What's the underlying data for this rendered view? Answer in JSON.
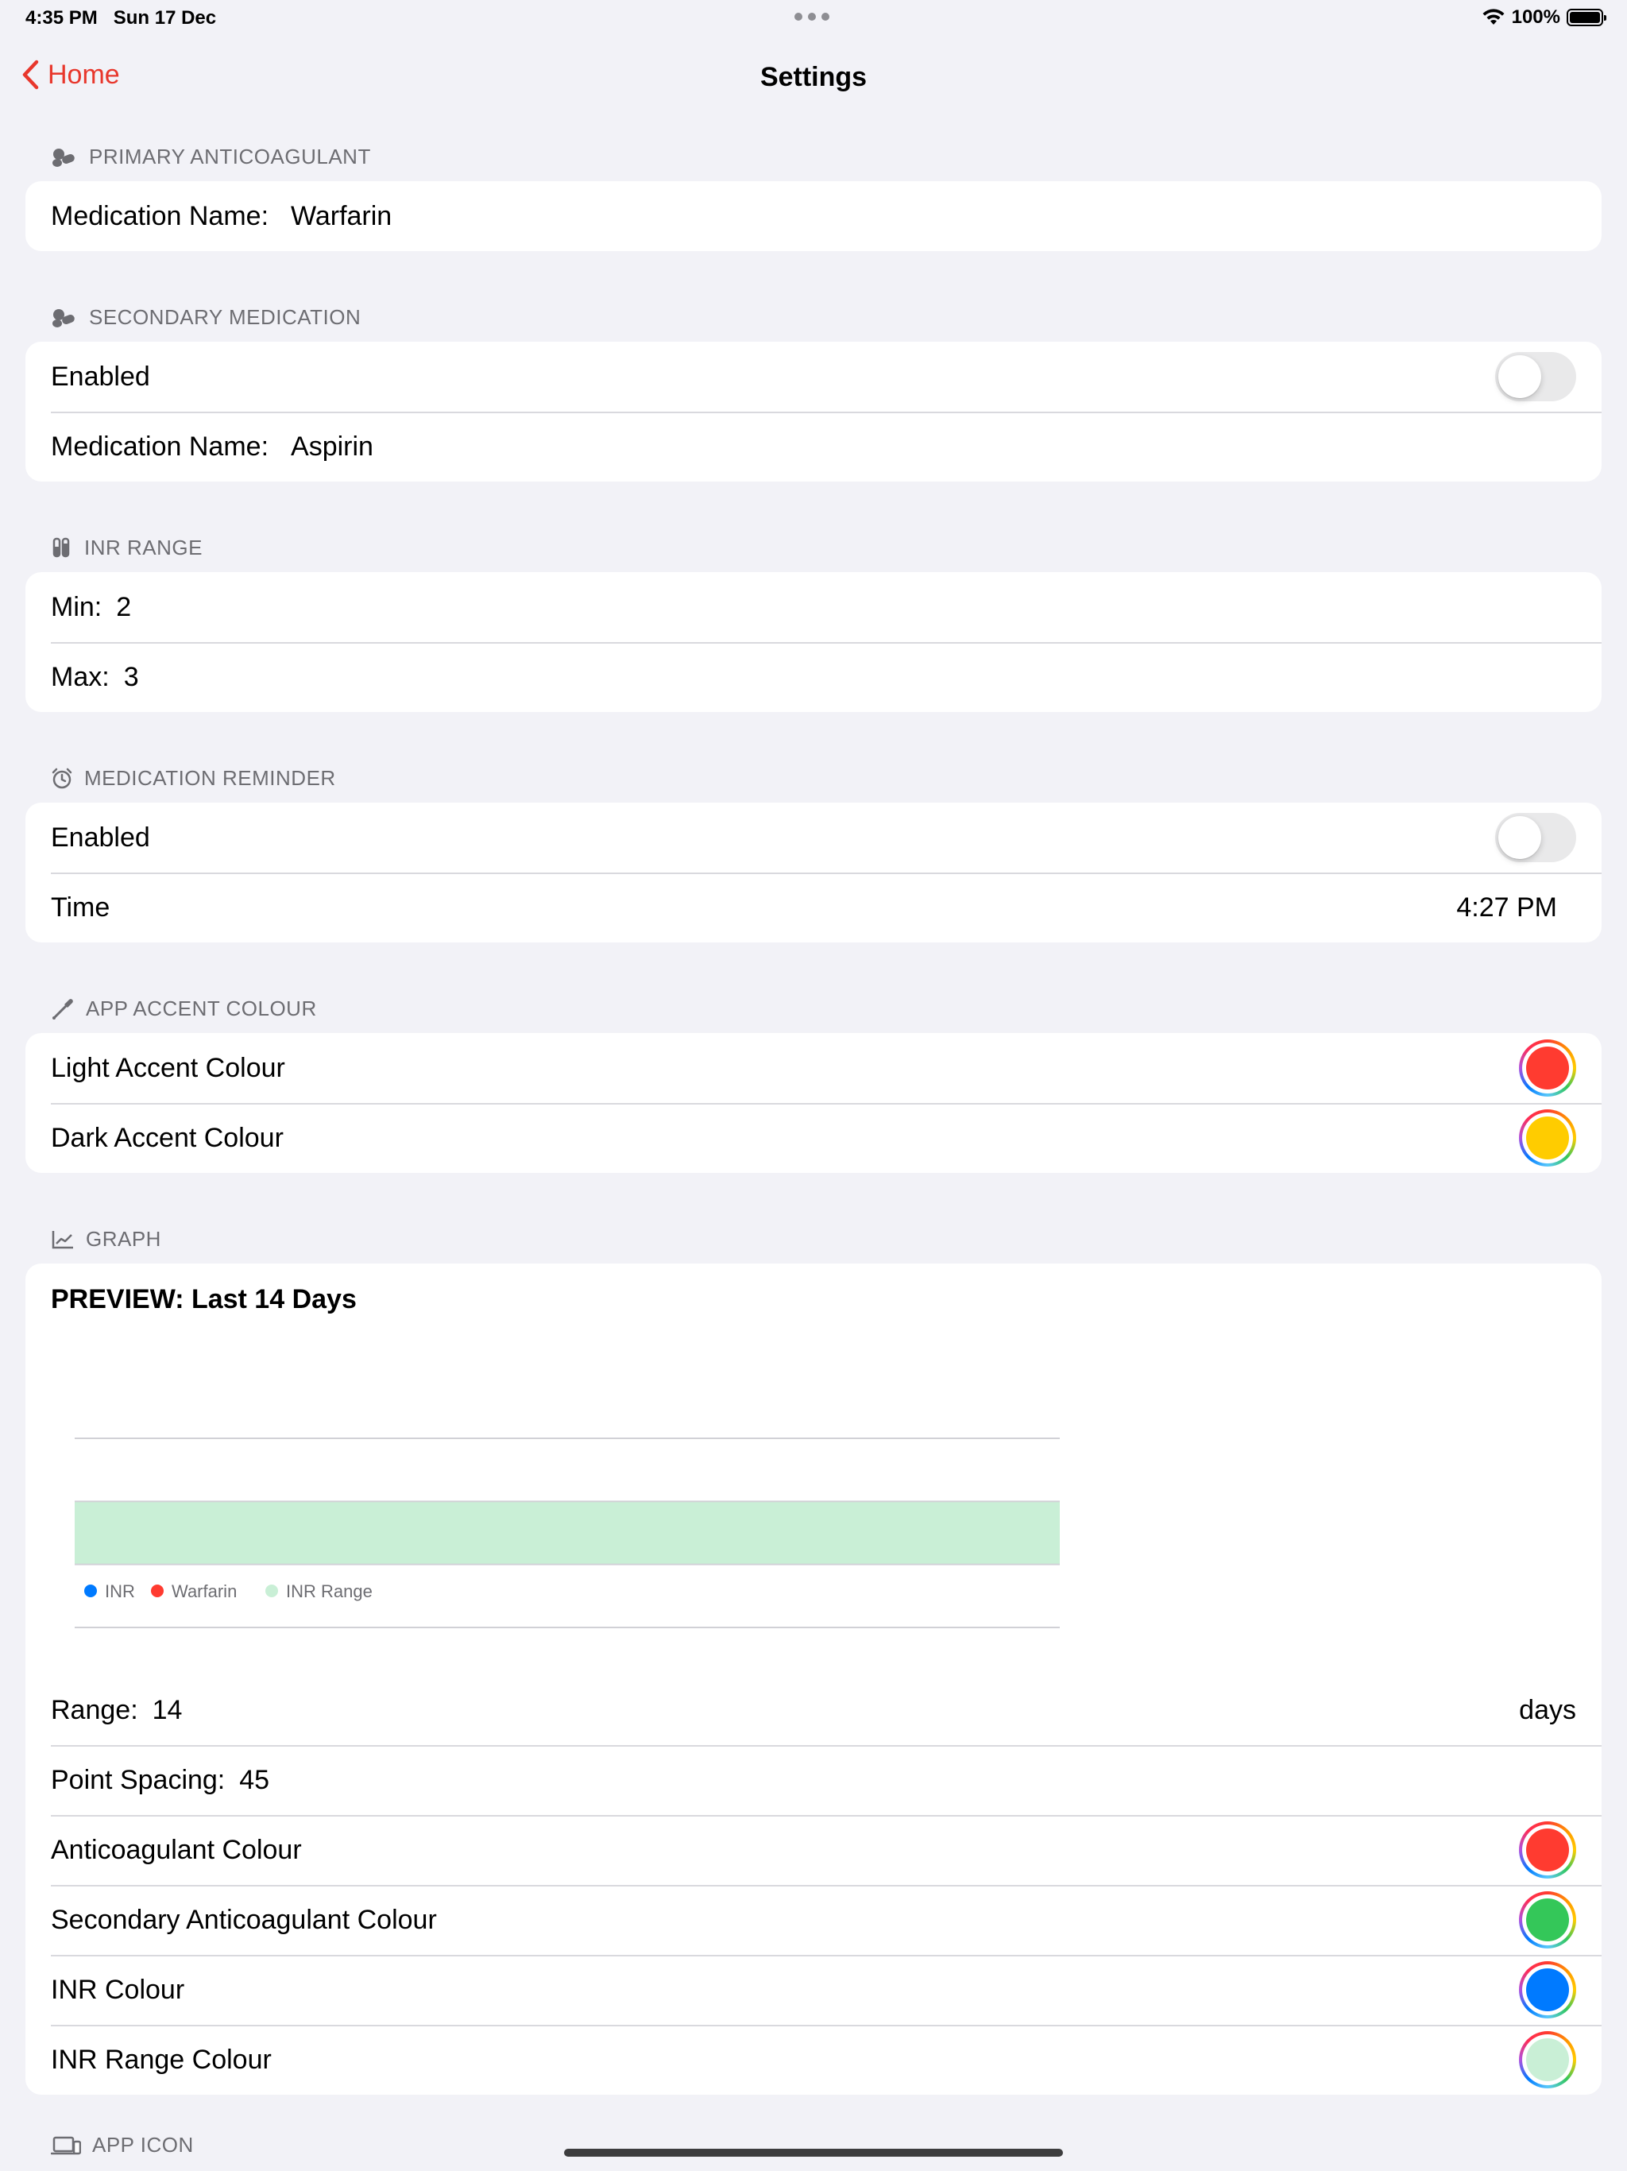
{
  "status_bar": {
    "time": "4:35 PM",
    "date": "Sun 17 Dec",
    "battery": "100%",
    "icons": [
      "wifi-icon",
      "battery-icon"
    ]
  },
  "nav": {
    "back_label": "Home",
    "title": "Settings"
  },
  "sections": {
    "primary": {
      "header": "PRIMARY ANTICOAGULANT",
      "medication_label": "Medication Name:",
      "medication_value": "Warfarin"
    },
    "secondary": {
      "header": "SECONDARY MEDICATION",
      "enabled_label": "Enabled",
      "enabled": false,
      "medication_label": "Medication Name:",
      "medication_value": "Aspirin"
    },
    "inr_range": {
      "header": "INR RANGE",
      "min_label": "Min:",
      "min_value": "2",
      "max_label": "Max:",
      "max_value": "3"
    },
    "reminder": {
      "header": "MEDICATION REMINDER",
      "enabled_label": "Enabled",
      "enabled": false,
      "time_label": "Time",
      "time_value": "4:27 PM"
    },
    "accent": {
      "header": "APP ACCENT COLOUR",
      "light_label": "Light Accent Colour",
      "light_color": "#ff3b30",
      "dark_label": "Dark Accent Colour",
      "dark_color": "#ffcc00"
    },
    "graph": {
      "header": "GRAPH",
      "preview_title": "PREVIEW: Last 14 Days",
      "range_label": "Range:",
      "range_value": "14",
      "range_unit": "days",
      "spacing_label": "Point Spacing:",
      "spacing_value": "45",
      "anticoagulant_label": "Anticoagulant Colour",
      "anticoagulant_color": "#ff3b30",
      "secondary_label": "Secondary Anticoagulant Colour",
      "secondary_color": "#34c759",
      "inr_label": "INR Colour",
      "inr_color": "#007aff",
      "inr_range_label": "INR Range Colour",
      "inr_range_color": "#c9efd6"
    },
    "app_icon": {
      "header": "APP ICON"
    }
  },
  "chart_data": {
    "type": "area",
    "title": "PREVIEW: Last 14 Days",
    "series": [
      {
        "name": "INR",
        "color": "#007aff",
        "values": []
      },
      {
        "name": "Warfarin",
        "color": "#ff3b30",
        "values": []
      },
      {
        "name": "INR Range",
        "color": "#c9efd6",
        "band": [
          2,
          3
        ]
      }
    ],
    "ylim": [
      1,
      4
    ],
    "grid": true,
    "legend": "bottom-left"
  }
}
